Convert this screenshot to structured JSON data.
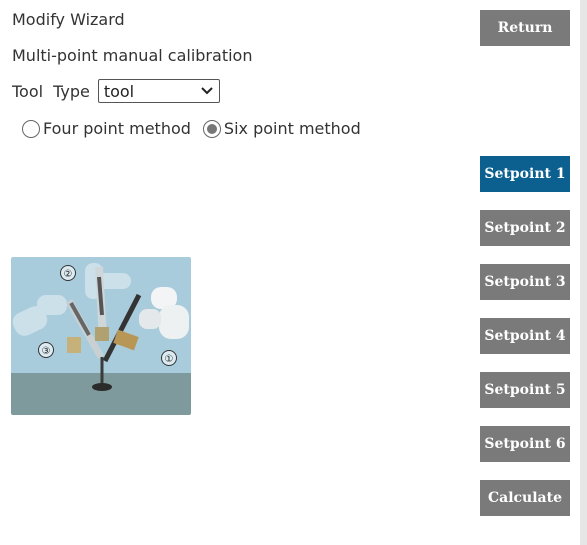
{
  "header": {
    "title": "Modify Wizard",
    "subtitle": "Multi-point manual calibration"
  },
  "tool_type": {
    "label_tool": "Tool",
    "label_type": "Type",
    "selected": "tool"
  },
  "method": {
    "options": [
      "Four point method",
      "Six point method"
    ],
    "selected_index": 1
  },
  "buttons": {
    "return": "Return",
    "setpoints": [
      "Setpoint 1",
      "Setpoint 2",
      "Setpoint 3",
      "Setpoint 4",
      "Setpoint 5",
      "Setpoint 6"
    ],
    "active_setpoint": 0,
    "calculate": "Calculate"
  },
  "illustration": {
    "markers": [
      "②",
      "③",
      "①"
    ]
  },
  "colors": {
    "button": "#7a7a7a",
    "active_button": "#0b6090",
    "sky": "#a9ccdd",
    "floor": "#7f9a9c"
  }
}
